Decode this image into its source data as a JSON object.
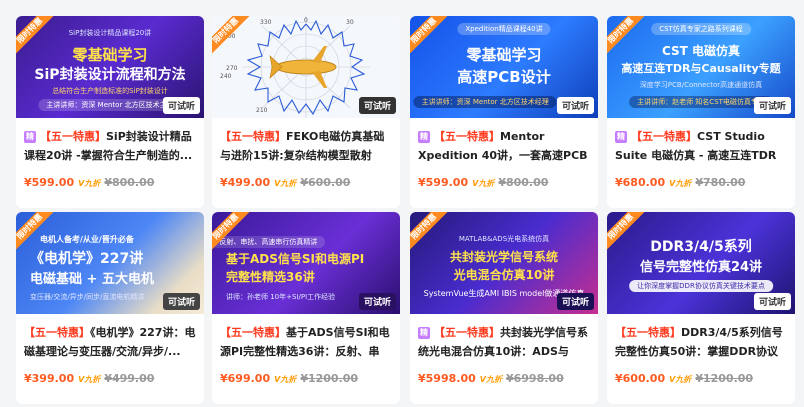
{
  "ribbon_label": "限时特惠",
  "try_label": "可试听",
  "vip_label": "V九折",
  "jing_label": "精",
  "courses": [
    {
      "thumb": {
        "small_top": "SiP封装设计精品课程20讲",
        "line1": "零基础学习",
        "line2": "SiP封装设计流程和方法",
        "sub": "总结符合生产制造标准的SiP封装设计",
        "pill": "主讲讲师：资深 Mentor 北方区技术主管"
      },
      "promo": "【五一特惠】",
      "title_rest": "SiP封装设计精品课程20讲 -掌握符合生产制造的...",
      "has_jing": true,
      "price": "¥599.00",
      "original_price": "¥800.00"
    },
    {
      "thumb": {
        "axis_labels": [
          "210",
          "240",
          "270",
          "300",
          "330",
          "0",
          "30"
        ]
      },
      "promo": "【五一特惠】",
      "title_rest": "FEKO电磁仿真基础与进阶15讲:复杂结构模型散射和...",
      "has_jing": false,
      "price": "¥499.00",
      "original_price": "¥600.00"
    },
    {
      "thumb": {
        "small_top": "Xpedition精品课程40讲",
        "line1": "零基础学习",
        "line2": "高速PCB设计",
        "pill": "主讲讲师：资深 Mentor 北方区技术经理"
      },
      "promo": "【五一特惠】",
      "title_rest": "Mentor Xpedition 40讲，一套高速PCB设计攻略",
      "has_jing": true,
      "price": "¥599.00",
      "original_price": "¥800.00"
    },
    {
      "thumb": {
        "small_top": "CST仿真专家之路系列课程",
        "line1": "CST 电磁仿真",
        "line2": "高速互连TDR与Causality专题",
        "sub": "深度学习PCB/Connector高速通道仿真",
        "pill": "主讲讲师：赵老师 知名CST电磁仿真专家"
      },
      "promo": "【五一特惠】",
      "title_rest": "CST Studio Suite 电磁仿真 - 高速互连TDR与Causa...",
      "has_jing": true,
      "price": "¥680.00",
      "original_price": "¥780.00"
    },
    {
      "thumb": {
        "small_top": "电机人备考/从业/晋升必备",
        "line1": "《电机学》227讲",
        "line2": "电磁基础 + 五大电机",
        "sub": "变压器/交流/异步/同步/直流电机精讲"
      },
      "promo": "【五一特惠】",
      "title_rest": "《电机学》227讲：电磁基理论与变压器/交流/异步/...",
      "has_jing": false,
      "price": "¥399.00",
      "original_price": "¥499.00"
    },
    {
      "thumb": {
        "small_top": "反射、串扰、高速串行仿真精讲",
        "line1": "基于ADS信号SI和电源PI",
        "line2": "完整性精选36讲",
        "pill": "讲师：孙老师 10年+SI/PI工作经验"
      },
      "promo": "【五一特惠】",
      "title_rest": "基于ADS信号SI和电源PI完整性精选36讲：反射、串扰、...",
      "has_jing": false,
      "price": "¥699.00",
      "original_price": "¥1200.00"
    },
    {
      "thumb": {
        "small_top": "MATLAB&ADS光电系统仿真",
        "line1": "共封装光学信号系统",
        "line2": "光电混合仿真10讲",
        "sub": "SystemVue生成AMI IBIS model做通道仿真"
      },
      "promo": "【五一特惠】",
      "title_rest": "共封装光学信号系统光电混合仿真10讲：ADS与MA...",
      "has_jing": true,
      "price": "¥5998.00",
      "original_price": "¥6998.00"
    },
    {
      "thumb": {
        "line1": "DDR3/4/5系列",
        "line2": "信号完整性仿真24讲",
        "pill": "让你深度掌握DDR协议仿真关键技术要点"
      },
      "promo": "【五一特惠】",
      "title_rest": "DDR3/4/5系列信号完整性仿真50讲：掌握DDR协议和...",
      "has_jing": false,
      "price": "¥600.00",
      "original_price": "¥1200.00"
    }
  ]
}
